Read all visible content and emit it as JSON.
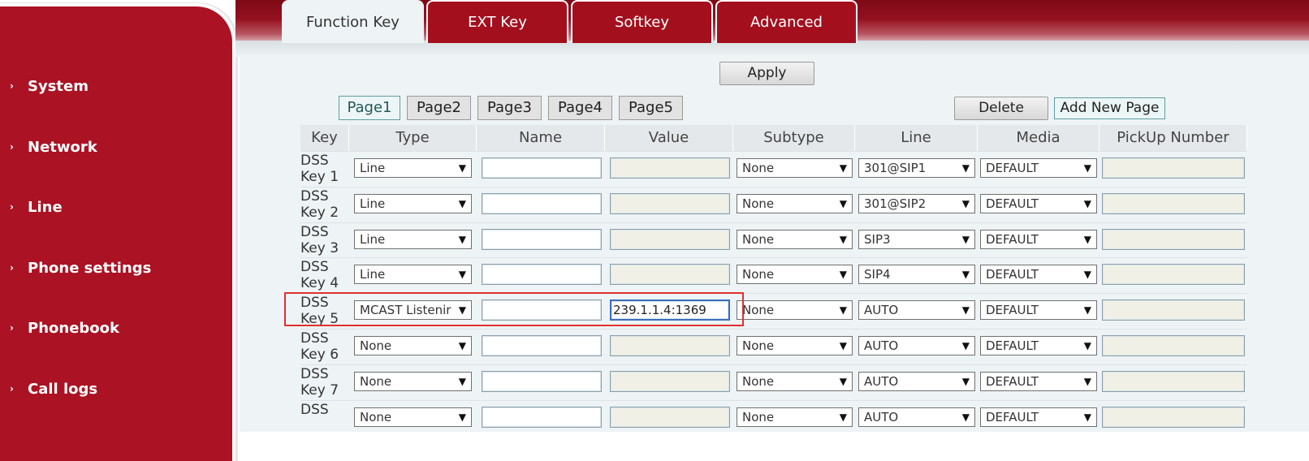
{
  "sidebar": {
    "items": [
      {
        "label": "System"
      },
      {
        "label": "Network"
      },
      {
        "label": "Line"
      },
      {
        "label": "Phone settings"
      },
      {
        "label": "Phonebook"
      },
      {
        "label": "Call logs"
      }
    ]
  },
  "tabs": [
    {
      "label": "Function Key",
      "active": true
    },
    {
      "label": "EXT Key"
    },
    {
      "label": "Softkey"
    },
    {
      "label": "Advanced"
    }
  ],
  "toolbar": {
    "apply_label": "Apply",
    "delete_label": "Delete",
    "add_page_label": "Add New Page"
  },
  "pages": [
    "Page1",
    "Page2",
    "Page3",
    "Page4",
    "Page5"
  ],
  "table": {
    "headers": [
      "Key",
      "Type",
      "Name",
      "Value",
      "Subtype",
      "Line",
      "Media",
      "PickUp Number"
    ],
    "rows": [
      {
        "key1": "DSS",
        "key2": "Key 1",
        "type": "Line",
        "name": "",
        "value": "",
        "subtype": "None",
        "line": "301@SIP1",
        "media": "DEFAULT",
        "pickup": ""
      },
      {
        "key1": "DSS",
        "key2": "Key 2",
        "type": "Line",
        "name": "",
        "value": "",
        "subtype": "None",
        "line": "301@SIP2",
        "media": "DEFAULT",
        "pickup": ""
      },
      {
        "key1": "DSS",
        "key2": "Key 3",
        "type": "Line",
        "name": "",
        "value": "",
        "subtype": "None",
        "line": "SIP3",
        "media": "DEFAULT",
        "pickup": ""
      },
      {
        "key1": "DSS",
        "key2": "Key 4",
        "type": "Line",
        "name": "",
        "value": "",
        "subtype": "None",
        "line": "SIP4",
        "media": "DEFAULT",
        "pickup": ""
      },
      {
        "key1": "DSS",
        "key2": "Key 5",
        "type": "MCAST Listenir",
        "name": "",
        "value": "239.1.1.4:1369",
        "subtype": "None",
        "line": "AUTO",
        "media": "DEFAULT",
        "pickup": ""
      },
      {
        "key1": "DSS",
        "key2": "Key 6",
        "type": "None",
        "name": "",
        "value": "",
        "subtype": "None",
        "line": "AUTO",
        "media": "DEFAULT",
        "pickup": ""
      },
      {
        "key1": "DSS",
        "key2": "Key 7",
        "type": "None",
        "name": "",
        "value": "",
        "subtype": "None",
        "line": "AUTO",
        "media": "DEFAULT",
        "pickup": ""
      },
      {
        "key1": "DSS",
        "key2": "",
        "type": "None",
        "name": "",
        "value": "",
        "subtype": "None",
        "line": "AUTO",
        "media": "DEFAULT",
        "pickup": ""
      }
    ]
  },
  "colors": {
    "brand": "#ab1223",
    "highlight": "#e03030",
    "focus": "#3a6fbe"
  },
  "icons": {
    "nav_arrow": "chevron-right-icon",
    "dropdown": "triangle-down-icon"
  }
}
